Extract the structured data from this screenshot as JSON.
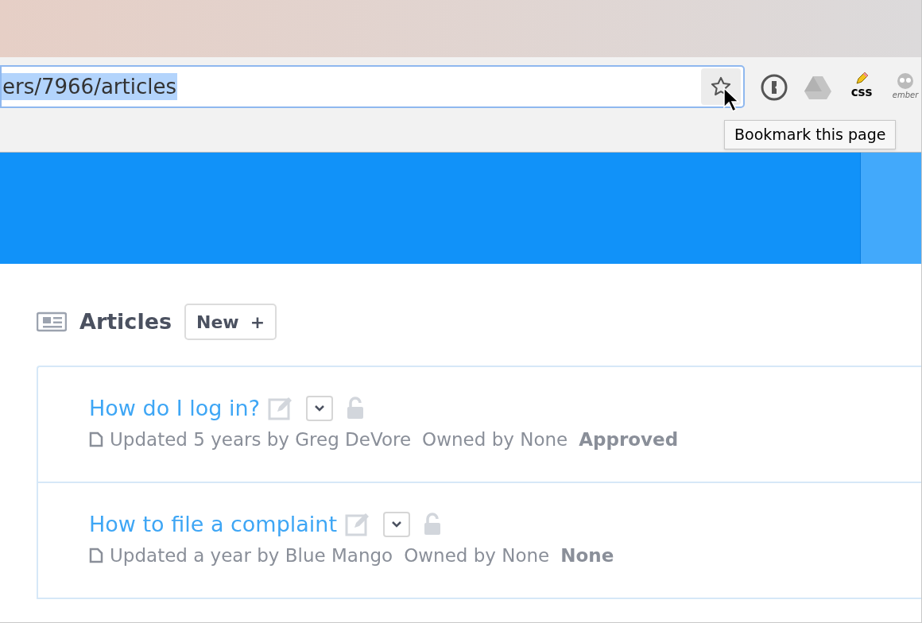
{
  "browser": {
    "url": "ers/7966/articles",
    "url_selected": true,
    "bookmark_tooltip": "Bookmark this page",
    "extensions": [
      {
        "kind": "password"
      },
      {
        "kind": "drive"
      },
      {
        "kind": "css",
        "label": "css"
      },
      {
        "kind": "ember",
        "label": "ember"
      }
    ]
  },
  "page": {
    "heading": "Articles",
    "new_button": "New",
    "new_icon": "+",
    "articles": [
      {
        "title": "How do I log in?",
        "meta": "Updated 5 years by Greg DeVore",
        "owner": "Owned by None",
        "status": "Approved",
        "locked": false
      },
      {
        "title": "How to file a complaint",
        "meta": "Updated a year by Blue Mango",
        "owner": "Owned by None",
        "status": "None",
        "locked": false
      }
    ]
  }
}
